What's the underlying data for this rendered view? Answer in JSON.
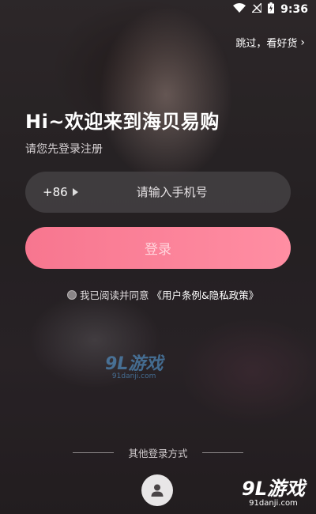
{
  "status_bar": {
    "time": "9:36",
    "icons": [
      "wifi-icon",
      "signal-off-icon",
      "battery-charging-icon"
    ]
  },
  "header": {
    "skip_label": "跳过，看好货",
    "skip_icon": "chevron-right-icon"
  },
  "welcome": {
    "title": "Hi~欢迎来到海贝易购",
    "subtitle": "请您先登录注册"
  },
  "phone": {
    "country_code": "+86",
    "placeholder": "请输入手机号",
    "value": ""
  },
  "login_button": {
    "label": "登录"
  },
  "agreement": {
    "prefix": "我已阅读并同意",
    "link": "《用户条例&隐私政策》",
    "checked": false
  },
  "other_login": {
    "label": "其他登录方式",
    "guest_icon": "user-icon"
  },
  "watermark": {
    "logo_text": "9L游戏",
    "url": "91danji.com"
  },
  "colors": {
    "accent_pink": "#f7768f",
    "input_bg": "#464244",
    "watermark_blue": "#5aa7e6"
  }
}
